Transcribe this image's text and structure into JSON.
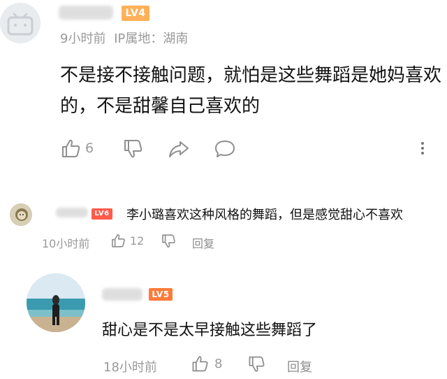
{
  "main_comment": {
    "level": "LV4",
    "time": "9小时前",
    "ip_location": "IP属地：湖南",
    "text": "不是接不接触问题，就怕是这些舞蹈是她妈喜欢的，不是甜馨自己喜欢的",
    "like_count": "6"
  },
  "reply_1": {
    "level": "LV6",
    "text": "李小璐喜欢这种风格的舞蹈，但是感觉甜心不喜欢",
    "time": "10小时前",
    "like_count": "12",
    "reply_label": "回复"
  },
  "reply_2": {
    "level": "LV5",
    "text": "甜心是不是太早接触这些舞蹈了",
    "time": "18小时前",
    "like_count": "8",
    "reply_label": "回复"
  },
  "colors": {
    "lv4": "#ffb15a",
    "lv5": "#ff7b3a",
    "lv6": "#ff5a4a",
    "meta_gray": "#9a9a9a"
  }
}
